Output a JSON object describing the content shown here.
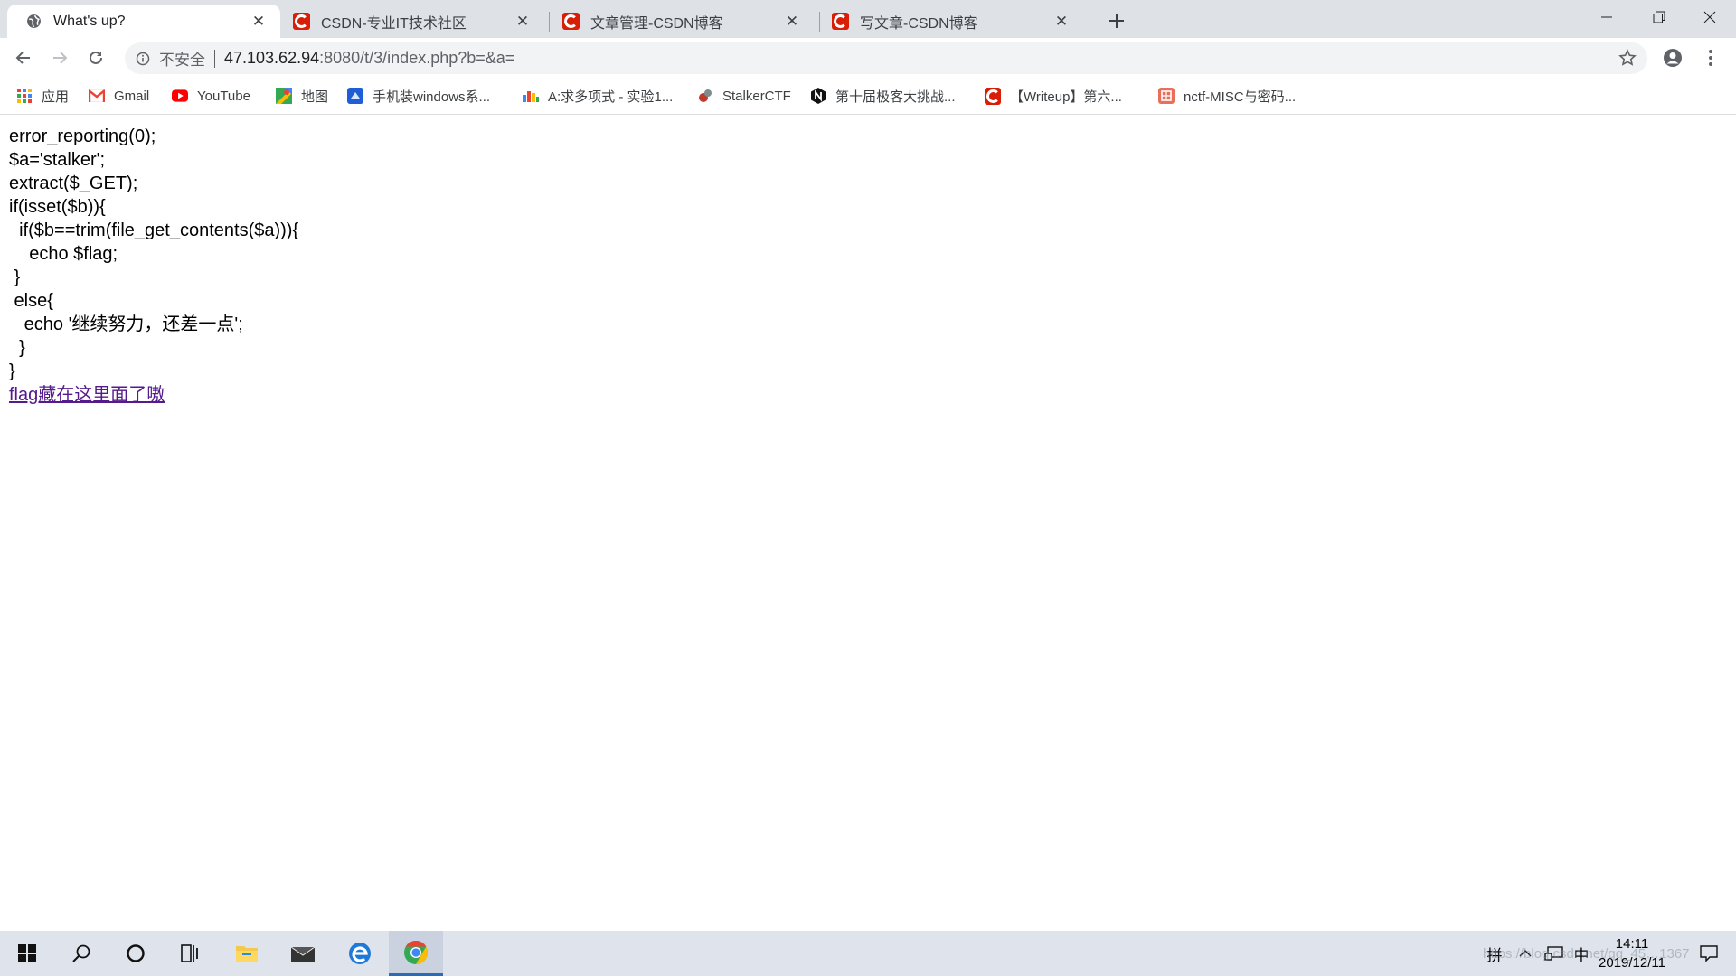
{
  "tabs": [
    {
      "title": "What's up?",
      "icon": "globe-icon",
      "active": true
    },
    {
      "title": "CSDN-专业IT技术社区",
      "icon": "csdn-icon",
      "active": false
    },
    {
      "title": "文章管理-CSDN博客",
      "icon": "csdn-icon",
      "active": false
    },
    {
      "title": "写文章-CSDN博客",
      "icon": "csdn-icon",
      "active": false
    }
  ],
  "address_bar": {
    "security_label": "不安全",
    "host": "47.103.62.94",
    "path": ":8080/t/3/index.php?b=&a="
  },
  "bookmarks": [
    {
      "label": "应用",
      "icon": "apps-grid-icon"
    },
    {
      "label": "Gmail",
      "icon": "gmail-icon"
    },
    {
      "label": "YouTube",
      "icon": "youtube-icon"
    },
    {
      "label": "地图",
      "icon": "maps-icon"
    },
    {
      "label": "手机装windows系...",
      "icon": "blue-app-icon"
    },
    {
      "label": "A:求多项式 - 实验1...",
      "icon": "bars-icon"
    },
    {
      "label": "StalkerCTF",
      "icon": "stalker-icon"
    },
    {
      "label": "第十届极客大挑战...",
      "icon": "n-circle-icon"
    },
    {
      "label": "【Writeup】第六...",
      "icon": "csdn-icon"
    },
    {
      "label": "nctf-MISC与密码...",
      "icon": "jianshu-icon"
    }
  ],
  "page": {
    "code_lines": [
      "error_reporting(0);",
      "$a='stalker';",
      "extract($_GET);",
      "if(isset($b)){",
      "  if($b==trim(file_get_contents($a))){",
      "    echo $flag;",
      " }",
      " else{",
      "   echo '继续努力，还差一点';",
      "  }",
      "}"
    ],
    "link_text": "flag藏在这里面了嗷"
  },
  "taskbar": {
    "ime_mode": "拼",
    "ime_lang": "中",
    "time": "14:11",
    "date": "2019/12/11"
  },
  "watermark": "https://blog.csdn.net/qq_45…1367",
  "colors": {
    "tabstrip": "#dee1e6",
    "csdn_red": "#d81e06",
    "link_visited": "#551a8b",
    "taskbar": "#dfe4ec"
  }
}
